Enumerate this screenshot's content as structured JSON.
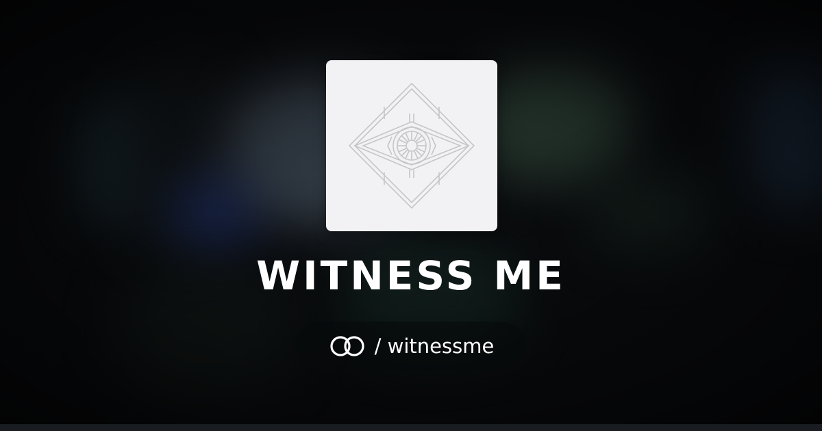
{
  "card": {
    "title": "WITNESS ME",
    "logo_icon": "eye-diamond-icon",
    "handle": {
      "brand_icon": "linked-rings-icon",
      "separator": "/",
      "username": "witnessme"
    }
  },
  "colors": {
    "logo_background": "#f2f2f4",
    "logo_stroke": "#c8c8cc",
    "title_text": "#ffffff",
    "pill_background": "#0a0c0e",
    "page_background": "#0c0e11"
  }
}
